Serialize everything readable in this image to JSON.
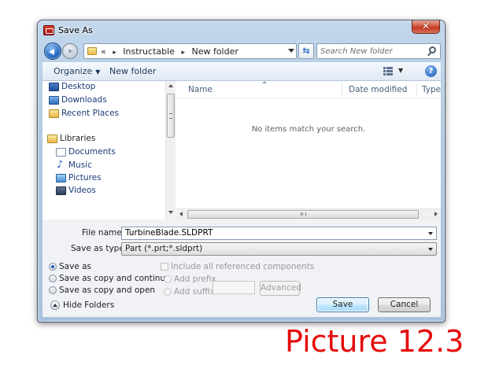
{
  "window": {
    "title": "Save As",
    "close_glyph": "✕"
  },
  "address_bar": {
    "prefix": "«",
    "crumbs": [
      "Instructable",
      "New folder"
    ],
    "separator": "▸",
    "refresh_glyph": "⇆"
  },
  "search": {
    "placeholder": "Search New folder"
  },
  "toolbar": {
    "organize_label": "Organize",
    "organize_caret": "▼",
    "new_folder_label": "New folder",
    "view_caret": "▼",
    "help_glyph": "?"
  },
  "nav_pane": {
    "favorites": [
      "Desktop",
      "Downloads",
      "Recent Places"
    ],
    "libraries_label": "Libraries",
    "library_items": [
      "Documents",
      "Music",
      "Pictures",
      "Videos"
    ]
  },
  "file_list": {
    "columns": [
      "Name",
      "Date modified",
      "Type"
    ],
    "empty_message": "No items match your search."
  },
  "form": {
    "file_name_label": "File name:",
    "file_name_value": "TurbineBlade.SLDPRT",
    "save_as_type_label": "Save as type:",
    "save_as_type_value": "Part (*.prt;*.sldprt)"
  },
  "options": {
    "save_as": "Save as",
    "save_as_copy_continue": "Save as copy and continue",
    "save_as_copy_open": "Save as copy and open",
    "include_referenced": "Include all referenced components",
    "add_prefix": "Add prefix",
    "add_suffix": "Add suffix",
    "advanced": "Advanced"
  },
  "buttons": {
    "save": "Save",
    "cancel": "Cancel",
    "hide_folders": "Hide Folders"
  },
  "caption": "Picture 12.3",
  "colors": {
    "caption_red": "#e60c0c",
    "link_blue": "#1a3b78",
    "accent_blue": "#1b5fbf"
  }
}
